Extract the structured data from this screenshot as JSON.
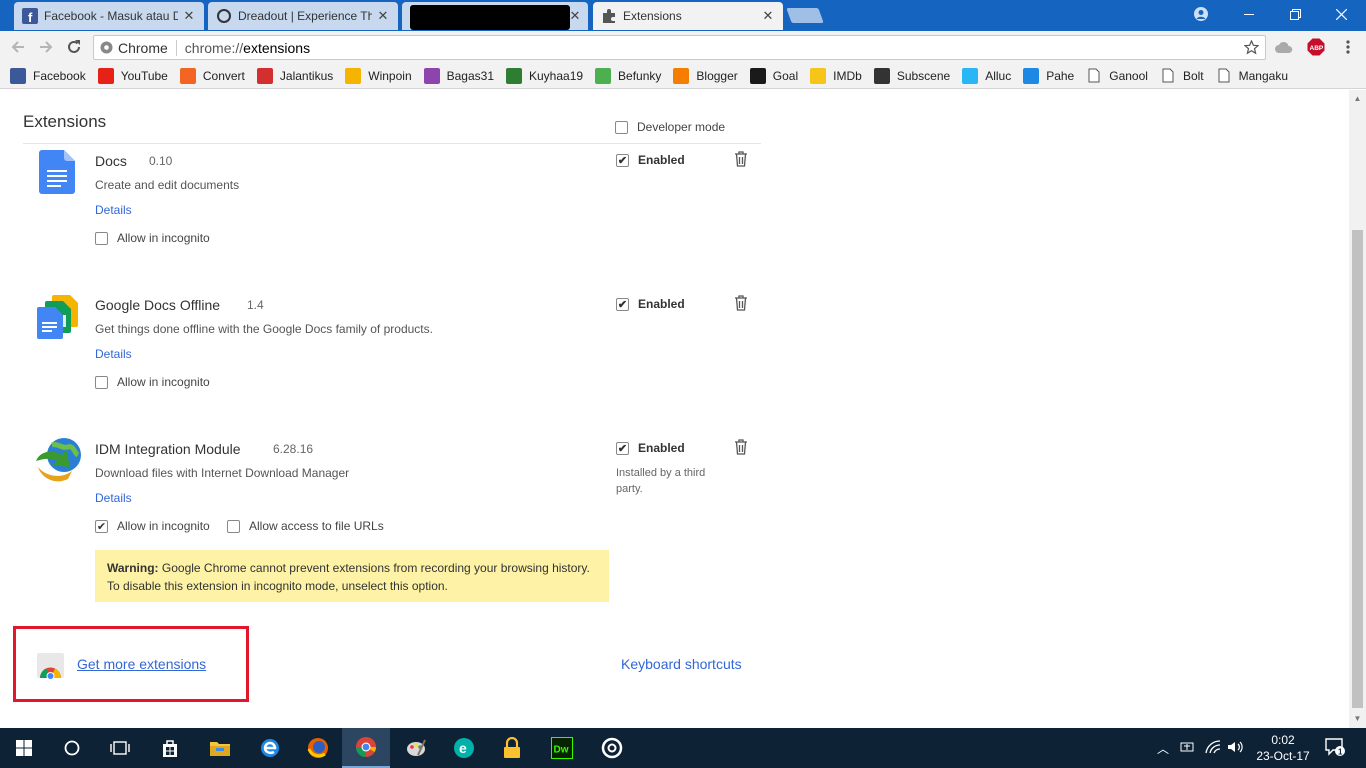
{
  "browser": {
    "tabs": [
      {
        "title": "Facebook - Masuk atau D",
        "icon": "facebook-icon"
      },
      {
        "title": "Dreadout | Experience Th",
        "icon": "loading-icon"
      },
      {
        "title": "",
        "icon": "redacted"
      },
      {
        "title": "Extensions",
        "icon": "puzzle-icon"
      }
    ],
    "omnibox": {
      "scheme_label": "Chrome",
      "url_prefix": "chrome://",
      "url_path": "extensions"
    },
    "bookmarks": [
      {
        "label": "Facebook",
        "icon": "facebook-icon",
        "color": "#3b5998"
      },
      {
        "label": "YouTube",
        "icon": "youtube-icon",
        "color": "#e62117"
      },
      {
        "label": "Convert",
        "icon": "convert-icon",
        "color": "#f26522"
      },
      {
        "label": "Jalantikus",
        "icon": "jalantikus-icon",
        "color": "#d32f2f"
      },
      {
        "label": "Winpoin",
        "icon": "winpoin-icon",
        "color": "#f4b400"
      },
      {
        "label": "Bagas31",
        "icon": "bagas31-icon",
        "color": "#8e44ad"
      },
      {
        "label": "Kuyhaa19",
        "icon": "kuyhaa-icon",
        "color": "#2e7d32"
      },
      {
        "label": "Befunky",
        "icon": "befunky-icon",
        "color": "#4caf50"
      },
      {
        "label": "Blogger",
        "icon": "blogger-icon",
        "color": "#f57d00"
      },
      {
        "label": "Goal",
        "icon": "goal-icon",
        "color": "#1a1a1a"
      },
      {
        "label": "IMDb",
        "icon": "imdb-icon",
        "color": "#f5c518"
      },
      {
        "label": "Subscene",
        "icon": "subscene-icon",
        "color": "#333333"
      },
      {
        "label": "Alluc",
        "icon": "alluc-icon",
        "color": "#29b6f6"
      },
      {
        "label": "Pahe",
        "icon": "pahe-icon",
        "color": "#1e88e5"
      },
      {
        "label": "Ganool",
        "icon": "page-icon",
        "color": "#ffffff"
      },
      {
        "label": "Bolt",
        "icon": "page-icon",
        "color": "#ffffff"
      },
      {
        "label": "Mangaku",
        "icon": "page-icon",
        "color": "#ffffff"
      }
    ]
  },
  "page": {
    "title": "Extensions",
    "developer_mode_label": "Developer mode",
    "extensions": [
      {
        "name": "Docs",
        "version": "0.10",
        "description": "Create and edit documents",
        "details_label": "Details",
        "incognito_label": "Allow in incognito",
        "incognito_checked": false,
        "enabled_label": "Enabled",
        "enabled": true
      },
      {
        "name": "Google Docs Offline",
        "version": "1.4",
        "description": "Get things done offline with the Google Docs family of products.",
        "details_label": "Details",
        "incognito_label": "Allow in incognito",
        "incognito_checked": false,
        "enabled_label": "Enabled",
        "enabled": true
      },
      {
        "name": "IDM Integration Module",
        "version": "6.28.16",
        "description": "Download files with Internet Download Manager",
        "details_label": "Details",
        "incognito_label": "Allow in incognito",
        "incognito_checked": true,
        "file_urls_label": "Allow access to file URLs",
        "file_urls_checked": false,
        "enabled_label": "Enabled",
        "enabled": true,
        "installed_note": "Installed by a third party.",
        "warning_bold": "Warning:",
        "warning_text": " Google Chrome cannot prevent extensions from recording your browsing history. To disable this extension in incognito mode, unselect this option."
      }
    ],
    "get_more_label": "Get more extensions",
    "keyboard_shortcuts_label": "Keyboard shortcuts"
  },
  "taskbar": {
    "time": "0:02",
    "date": "23-Oct-17",
    "notification_count": "1",
    "apps": [
      "start-icon",
      "cortana-icon",
      "task-view-icon",
      "store-icon",
      "file-explorer-icon",
      "edge-icon",
      "firefox-icon",
      "chrome-icon",
      "paint-icon",
      "e-app-icon",
      "lock-app-icon",
      "dreamweaver-icon",
      "groove-icon"
    ]
  },
  "colors": {
    "titlebar": "#1565c0",
    "link": "#3367d6",
    "warning_bg": "#fdf2a5",
    "highlight": "#e2172c",
    "taskbar": "#0e2236"
  }
}
